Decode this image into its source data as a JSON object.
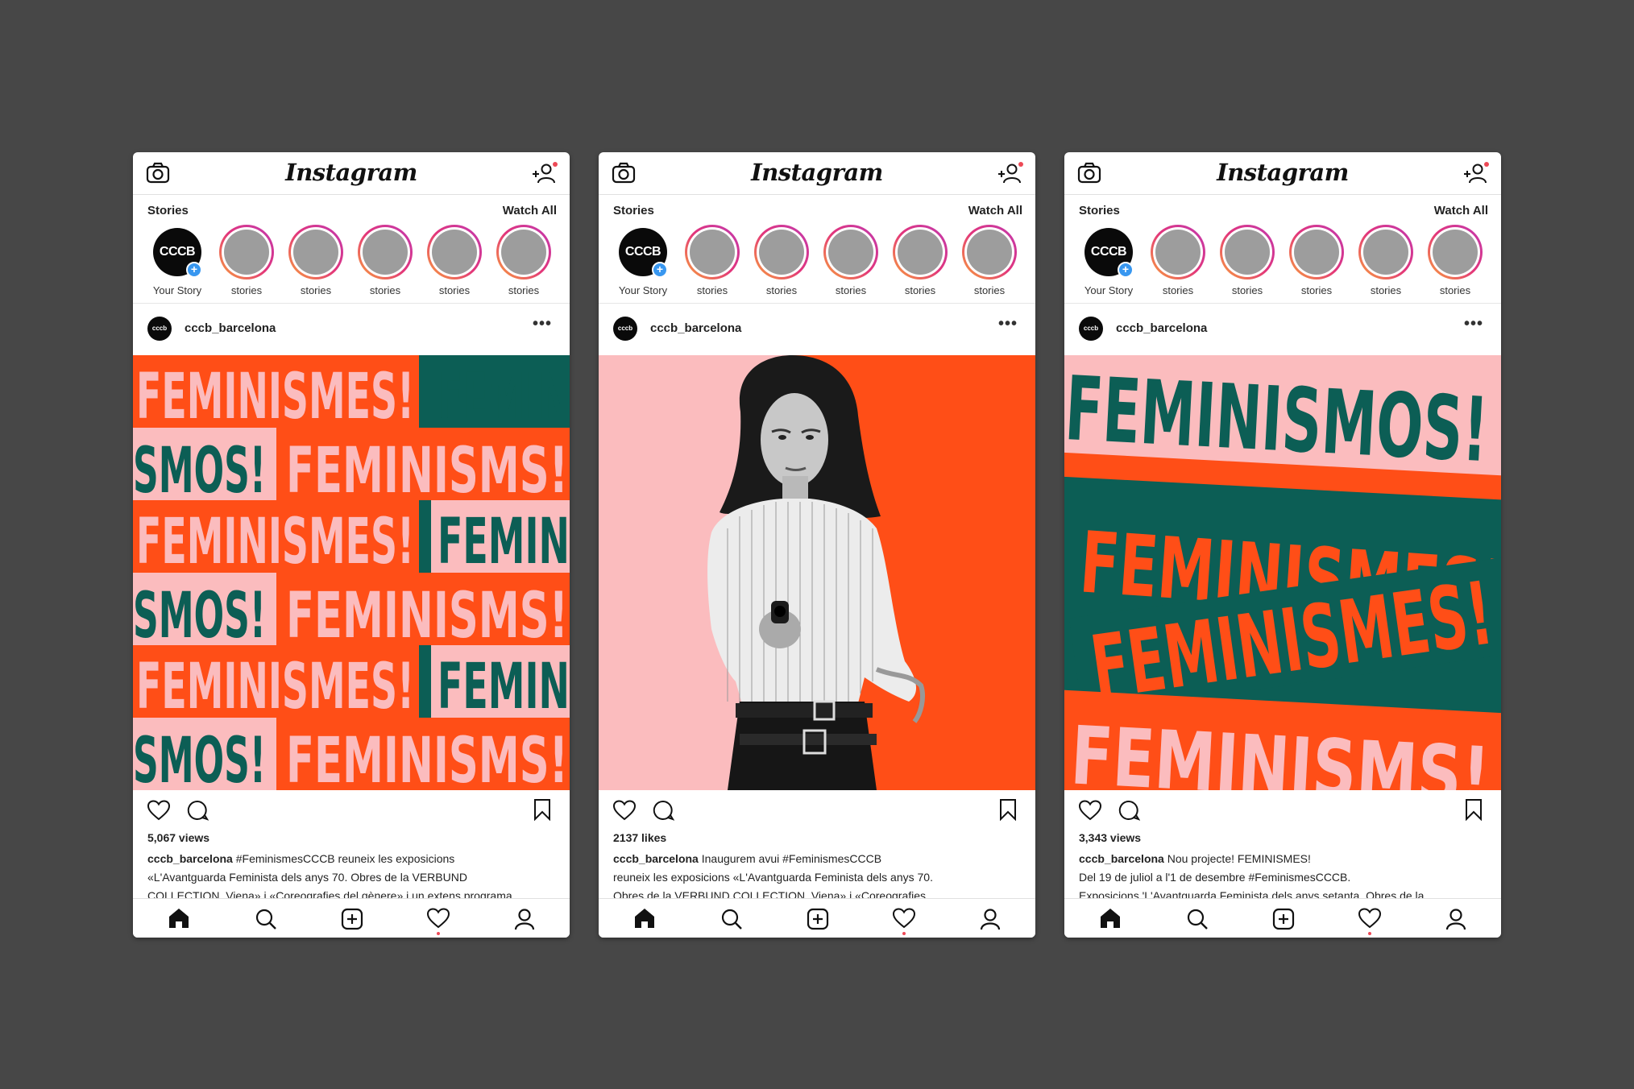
{
  "phones": [
    {
      "header": {
        "title": "Instagram"
      },
      "stories": {
        "title": "Stories",
        "watch_all": "Watch All",
        "your_story_avatar": "CCCB",
        "your_story_label": "Your Story",
        "items": [
          "stories",
          "stories",
          "stories",
          "stories",
          "stories"
        ]
      },
      "post": {
        "username": "cccb_barcelona",
        "avatar_text": "cccb",
        "more": "•••",
        "image_text": {
          "line_a_1": "FEMINISMES!",
          "line_a_2": "FEMIN",
          "line_b_1": "SMOS!",
          "line_b_2": "FEMINISMS!"
        },
        "count": "5,067 views",
        "caption_user": "cccb_barcelona",
        "caption_1": " #FeminismesCCCB reuneix les exposicions",
        "caption_2": "«L'Avantguarda Feminista dels anys 70. Obres de la VERBUND",
        "caption_3": "COLLECTION, Viena» i «Coreografies del gènere» i un extens programa"
      }
    },
    {
      "header": {
        "title": "Instagram"
      },
      "stories": {
        "title": "Stories",
        "watch_all": "Watch All",
        "your_story_avatar": "CCCB",
        "your_story_label": "Your Story",
        "items": [
          "stories",
          "stories",
          "stories",
          "stories",
          "stories"
        ]
      },
      "post": {
        "username": "cccb_barcelona",
        "avatar_text": "cccb",
        "more": "•••",
        "count": "2137 likes",
        "caption_user": "cccb_barcelona",
        "caption_1": " Inaugurem avui #FeminismesCCCB",
        "caption_2": "reuneix les exposicions «L'Avantguarda Feminista dels anys 70.",
        "caption_3": "Obres de la VERBUND COLLECTION, Viena» i «Coreografies"
      }
    },
    {
      "header": {
        "title": "Instagram"
      },
      "stories": {
        "title": "Stories",
        "watch_all": "Watch All",
        "your_story_avatar": "CCCB",
        "your_story_label": "Your Story",
        "items": [
          "stories",
          "stories",
          "stories",
          "stories",
          "stories"
        ]
      },
      "post": {
        "username": "cccb_barcelona",
        "avatar_text": "cccb",
        "more": "•••",
        "image_text": {
          "t1": "FEMINISMOS!",
          "t2": "FEMINISMES!",
          "t3": "FEMINISMES!",
          "t4": "FEMINISMS!"
        },
        "count": "3,343 views",
        "caption_user": "cccb_barcelona",
        "caption_1": " Nou projecte! FEMINISMES!",
        "caption_2": "Del 19 de juliol a l'1 de desembre #FeminismesCCCB.",
        "caption_3": "Exposicions 'L'Avantguarda Feminista dels anys setanta. Obres de la"
      }
    }
  ],
  "colors": {
    "green": "#0c5e55",
    "orange": "#ff4e17",
    "pink": "#fbbcbe",
    "background": "#474747"
  }
}
